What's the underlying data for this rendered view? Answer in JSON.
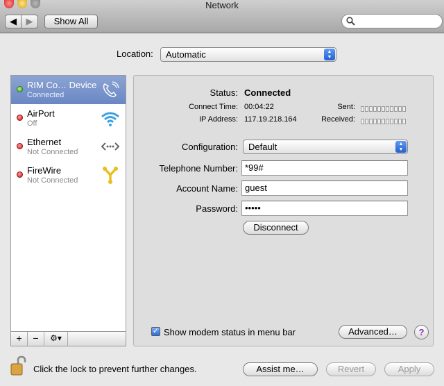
{
  "window": {
    "title": "Network"
  },
  "toolbar": {
    "back": "◀",
    "forward": "▶",
    "show_all": "Show All"
  },
  "search": {
    "placeholder": ""
  },
  "location": {
    "label": "Location:",
    "value": "Automatic"
  },
  "services": [
    {
      "name": "RIM Co… Device",
      "status": "Connected",
      "state": "connected",
      "icon": "phone-icon"
    },
    {
      "name": "AirPort",
      "status": "Off",
      "state": "off",
      "icon": "wifi-icon"
    },
    {
      "name": "Ethernet",
      "status": "Not Connected",
      "state": "off",
      "icon": "ethernet-icon"
    },
    {
      "name": "FireWire",
      "status": "Not Connected",
      "state": "off",
      "icon": "firewire-icon"
    }
  ],
  "list_bar": {
    "add": "+",
    "remove": "−",
    "gear": "⚙▾"
  },
  "detail": {
    "status_label": "Status:",
    "status_value": "Connected",
    "connect_time_label": "Connect Time:",
    "connect_time_value": "00:04:22",
    "ip_label": "IP Address:",
    "ip_value": "117.19.218.164",
    "sent_label": "Sent:",
    "received_label": "Received:",
    "configuration_label": "Configuration:",
    "configuration_value": "Default",
    "phone_label": "Telephone Number:",
    "phone_value": "*99#",
    "account_label": "Account Name:",
    "account_value": "guest",
    "password_label": "Password:",
    "password_value": "•••••",
    "disconnect": "Disconnect",
    "modem_status": "Show modem status in menu bar",
    "advanced": "Advanced…",
    "help": "?"
  },
  "footer": {
    "lock_text": "Click the lock to prevent further changes.",
    "assist": "Assist me…",
    "revert": "Revert",
    "apply": "Apply"
  },
  "colors": {
    "selection": "#7791c9",
    "connected": "#3ea11b",
    "disconnected": "#cc1a1a",
    "help": "#8a2ab8"
  }
}
